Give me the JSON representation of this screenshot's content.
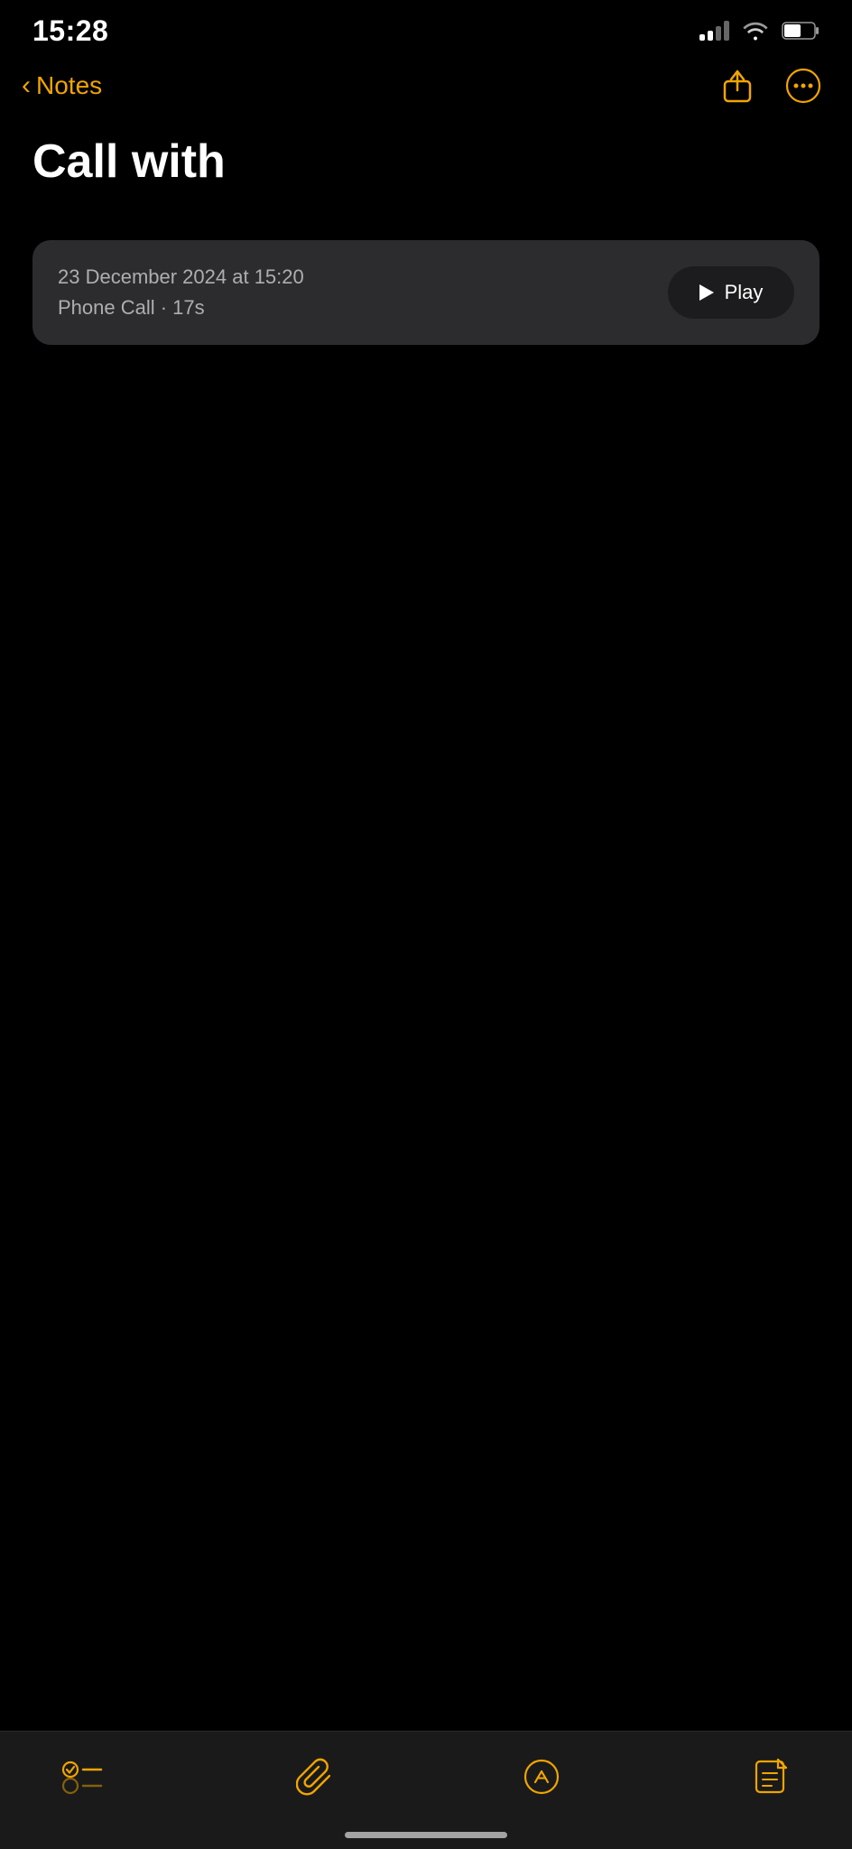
{
  "statusBar": {
    "time": "15:28",
    "signalLabel": "signal",
    "wifiLabel": "wifi",
    "batteryLabel": "battery"
  },
  "navBar": {
    "backLabel": "Notes",
    "shareIconLabel": "share",
    "moreIconLabel": "more options"
  },
  "note": {
    "title": "Call with"
  },
  "audioCard": {
    "date": "23 December 2024 at 15:20",
    "meta": "Phone Call · 17s",
    "playLabel": "Play"
  },
  "toolbar": {
    "checklistLabel": "checklist",
    "attachmentLabel": "attachment",
    "composeLabel": "compose",
    "newNoteLabel": "new note"
  }
}
